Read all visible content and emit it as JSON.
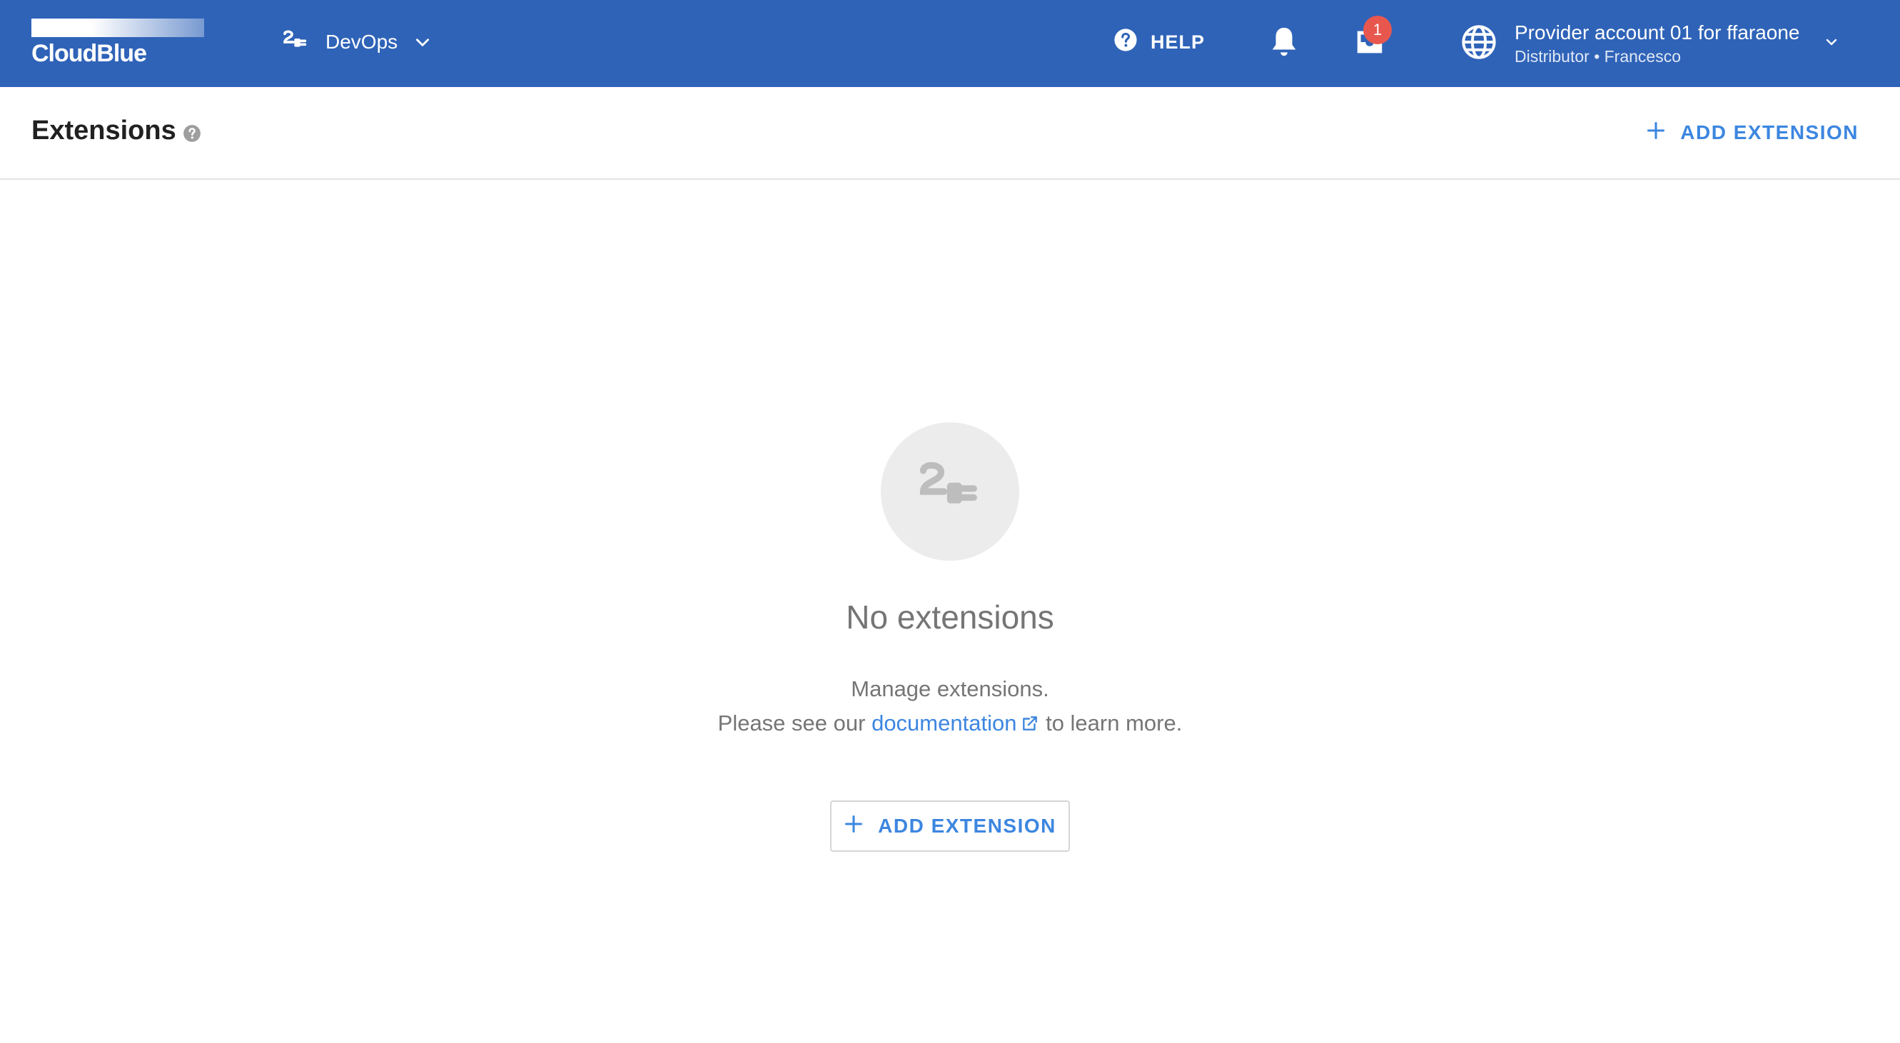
{
  "brand": {
    "logo_text": "CloudBlue",
    "primary_color": "#2f63b8",
    "accent_color": "#3c86e0",
    "badge_color": "#e8574e"
  },
  "topbar": {
    "module": {
      "label": "DevOps",
      "icon": "plug-icon"
    },
    "help_label": "HELP",
    "notifications_icon": "bell-icon",
    "inbox": {
      "icon": "inbox-icon",
      "badge_count": "1"
    },
    "account": {
      "name": "Provider account 01 for ffaraone",
      "subtitle": "Distributor • Francesco",
      "icon": "globe-icon"
    }
  },
  "header": {
    "title": "Extensions",
    "add_button_label": "ADD EXTENSION"
  },
  "empty_state": {
    "icon": "plug-icon",
    "title": "No extensions",
    "line1": "Manage extensions.",
    "line2_prefix": "Please see our",
    "link_text": "documentation",
    "line2_suffix": "to learn more.",
    "button_label": "ADD EXTENSION"
  }
}
